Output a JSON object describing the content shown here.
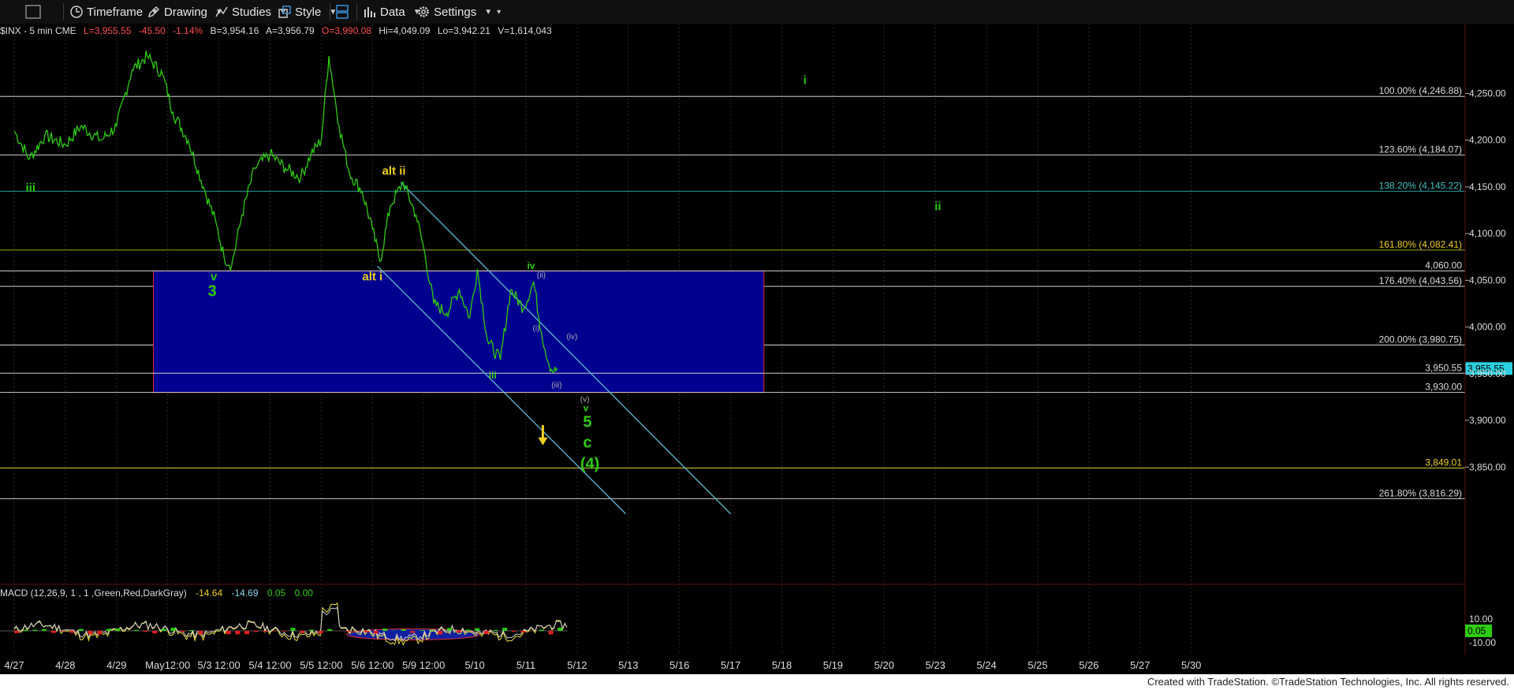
{
  "toolbar": {
    "timeframe": "Timeframe",
    "drawing": "Drawing",
    "studies": "Studies",
    "style": "Style",
    "data": "Data",
    "settings": "Settings"
  },
  "header": {
    "symbol": "$INX - 5 min  CME",
    "last": "L=3,955.55",
    "change": "-45.50",
    "change_pct": "-1.14%",
    "bid": "B=3,954.16",
    "ask": "A=3,956.79",
    "open": "O=3,990.08",
    "high": "Hi=4,049.09",
    "low": "Lo=3,942.21",
    "volume": "V=1,614,043"
  },
  "colors": {
    "background": "#000000",
    "price_line": "#2ecc10",
    "box_fill": "#000090",
    "box_border": "#e03030",
    "wave_green": "#2ecc10",
    "wave_yellow": "#f0d020",
    "channel": "#5ab0c8",
    "fib_line": "#cfcfcf",
    "last_badge": "#2bd0e0"
  },
  "chart_data": {
    "type": "line",
    "symbol": "$INX",
    "interval": "5 min",
    "ylim": [
      3800,
      4300
    ],
    "y_ticks": [
      "4,250.00",
      "4,200.00",
      "4,150.00",
      "4,100.00",
      "4,050.00",
      "4,000.00",
      "3,950.00",
      "3,900.00",
      "3,850.00"
    ],
    "y_tick_values": [
      4250,
      4200,
      4150,
      4100,
      4050,
      4000,
      3950,
      3900,
      3850
    ],
    "x_ticks": [
      "4/27",
      "4/28",
      "4/29",
      "May12:00",
      "5/3 12:00",
      "5/4 12:00",
      "5/5 12:00",
      "5/6 12:00",
      "5/9 12:00",
      "5/10",
      "5/11",
      "5/12",
      "5/13",
      "5/16",
      "5/17",
      "5/18",
      "5/19",
      "5/20",
      "5/23",
      "5/24",
      "5/25",
      "5/26",
      "5/27",
      "5/30"
    ],
    "price_path": [
      [
        0,
        4210
      ],
      [
        0.3,
        4180
      ],
      [
        0.6,
        4205
      ],
      [
        1.0,
        4195
      ],
      [
        1.3,
        4215
      ],
      [
        1.7,
        4200
      ],
      [
        2.0,
        4215
      ],
      [
        2.3,
        4275
      ],
      [
        2.6,
        4290
      ],
      [
        2.9,
        4270
      ],
      [
        3.1,
        4230
      ],
      [
        3.4,
        4200
      ],
      [
        3.7,
        4150
      ],
      [
        3.95,
        4110
      ],
      [
        4.1,
        4075
      ],
      [
        4.25,
        4066
      ],
      [
        4.45,
        4120
      ],
      [
        4.7,
        4170
      ],
      [
        5.0,
        4185
      ],
      [
        5.3,
        4170
      ],
      [
        5.6,
        4160
      ],
      [
        5.8,
        4185
      ],
      [
        6.0,
        4200
      ],
      [
        6.15,
        4290
      ],
      [
        6.35,
        4215
      ],
      [
        6.55,
        4165
      ],
      [
        6.8,
        4145
      ],
      [
        7.0,
        4105
      ],
      [
        7.15,
        4070
      ],
      [
        7.35,
        4130
      ],
      [
        7.6,
        4155
      ],
      [
        7.85,
        4120
      ],
      [
        8.0,
        4085
      ],
      [
        8.2,
        4025
      ],
      [
        8.45,
        4015
      ],
      [
        8.7,
        4040
      ],
      [
        8.9,
        4010
      ],
      [
        9.05,
        4062
      ],
      [
        9.25,
        3985
      ],
      [
        9.5,
        3965
      ],
      [
        9.7,
        4040
      ],
      [
        9.95,
        4020
      ],
      [
        10.15,
        4048
      ],
      [
        10.3,
        3995
      ],
      [
        10.45,
        3960
      ],
      [
        10.55,
        3952
      ],
      [
        10.62,
        3955.55
      ]
    ],
    "fib_levels": [
      {
        "label": "100.00% (4,246.88)",
        "value": 4246.88
      },
      {
        "label": "123.60% (4,184.07)",
        "value": 4184.07
      },
      {
        "label": "138.20% (4,145.22)",
        "value": 4145.22
      },
      {
        "label": "161.80% (4,082.41)",
        "value": 4082.41
      },
      {
        "label": "176.40% (4,043.56)",
        "value": 4043.56
      },
      {
        "label": "200.00% (3,980.75)",
        "value": 3980.75
      },
      {
        "label": "261.80% (3,816.29)",
        "value": 3816.29
      }
    ],
    "horizontal_levels": [
      {
        "label": "4,060.00",
        "value": 4060.0
      },
      {
        "label": "3,950.55",
        "value": 3950.55
      },
      {
        "label": "3,930.00",
        "value": 3930.0
      },
      {
        "label": "3,849.01",
        "value": 3849.01
      }
    ],
    "target_box": {
      "x_start": 2.72,
      "x_end": 14.65,
      "top": 4060.0,
      "bottom": 3930.0
    },
    "last_price": "3,955.55",
    "last_price_value": 3955.55,
    "channel_lines": [
      {
        "from": [
          7.1,
          4065
        ],
        "to": [
          11.95,
          3800
        ]
      },
      {
        "from": [
          7.55,
          4155
        ],
        "to": [
          14.0,
          3800
        ]
      }
    ],
    "wave_labels": [
      {
        "text": "iii",
        "x": 0.32,
        "value": 4145,
        "color": "green",
        "size": "medium"
      },
      {
        "text": "v",
        "x": 3.9,
        "value": 4050,
        "color": "green",
        "size": "medium"
      },
      {
        "text": "3",
        "x": 3.87,
        "value": 4033,
        "color": "green",
        "size": "large"
      },
      {
        "text": "alt i",
        "x": 7.0,
        "value": 4050,
        "color": "yellow",
        "size": "medium"
      },
      {
        "text": "alt ii",
        "x": 7.42,
        "value": 4163,
        "color": "yellow",
        "size": "medium"
      },
      {
        "text": "iii",
        "x": 9.35,
        "value": 3945,
        "color": "green",
        "size": "small"
      },
      {
        "text": "iv",
        "x": 10.1,
        "value": 4062,
        "color": "green",
        "size": "small"
      },
      {
        "text": "(ii)",
        "x": 10.3,
        "value": 4053,
        "color": "gray",
        "size": "tiny"
      },
      {
        "text": "(i)",
        "x": 10.2,
        "value": 3996,
        "color": "gray",
        "size": "tiny"
      },
      {
        "text": "(iv)",
        "x": 10.9,
        "value": 3987,
        "color": "gray",
        "size": "tiny"
      },
      {
        "text": "(iii)",
        "x": 10.6,
        "value": 3935,
        "color": "gray",
        "size": "tiny"
      },
      {
        "text": "(v)",
        "x": 11.15,
        "value": 3920,
        "color": "gray",
        "size": "tiny"
      },
      {
        "text": "v",
        "x": 11.17,
        "value": 3910,
        "color": "green",
        "size": "small"
      },
      {
        "text": "5",
        "x": 11.2,
        "value": 3893,
        "color": "green",
        "size": "large"
      },
      {
        "text": "c",
        "x": 11.2,
        "value": 3871,
        "color": "green",
        "size": "large"
      },
      {
        "text": "(4)",
        "x": 11.25,
        "value": 3848,
        "color": "green",
        "size": "large"
      },
      {
        "text": "i",
        "x": 15.45,
        "value": 4260,
        "color": "green",
        "size": "medium"
      },
      {
        "text": "ii",
        "x": 18.05,
        "value": 4125,
        "color": "green",
        "size": "medium"
      }
    ],
    "arrow": {
      "x": 10.33,
      "from": 3895,
      "to": 3875,
      "color": "yellow"
    },
    "macd": {
      "label": "MACD (12,26,9, 1 , 1 ,Green,Red,DarkGray)",
      "value_macd": "-14.64",
      "value_avg": "-14.69",
      "value_diff": "0.05",
      "value_zero": "0.00",
      "y_ticks": [
        "10.00",
        "-10.00"
      ],
      "last_value": "0.05"
    }
  },
  "footer": {
    "credit": "Created with TradeStation. ©TradeStation Technologies, Inc. All rights reserved."
  }
}
